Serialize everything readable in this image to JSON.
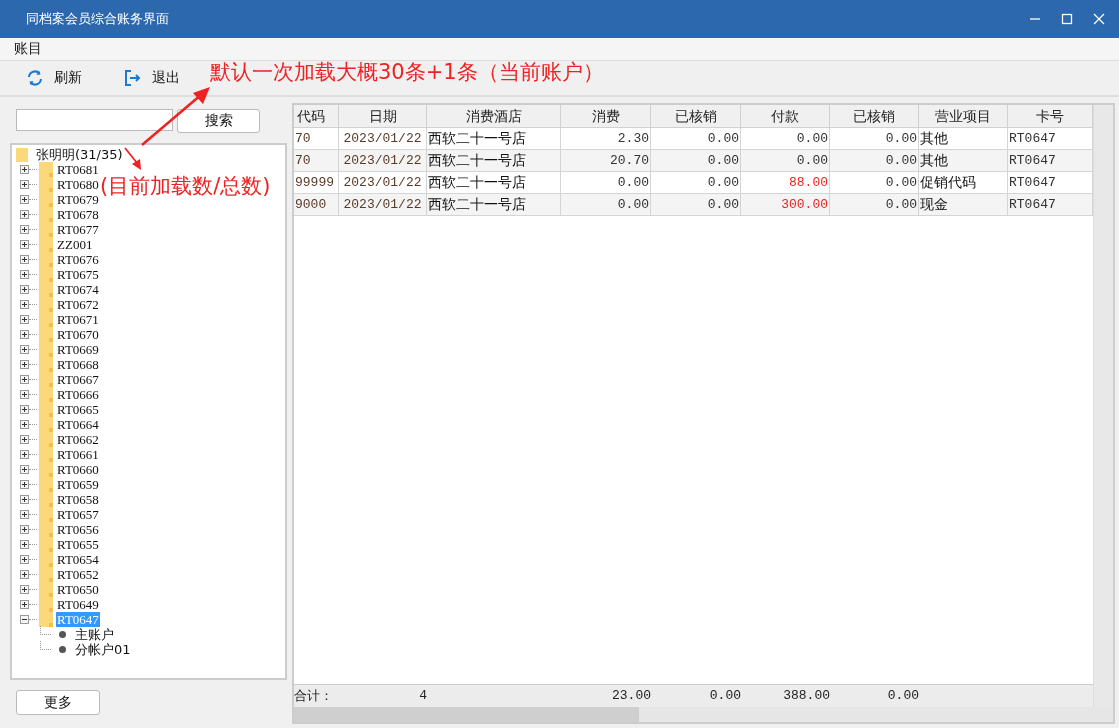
{
  "window": {
    "title": "同档案会员综合账务界面"
  },
  "menu": [
    "账目"
  ],
  "toolbar": [
    {
      "kind": "refresh",
      "label": "刷新"
    },
    {
      "kind": "exit",
      "label": "退出"
    }
  ],
  "search": {
    "button": "搜索"
  },
  "tree": {
    "label": "张明明(31/35)",
    "children": [
      {
        "label": "RT0681",
        "expanded": false,
        "selected": false
      },
      {
        "label": "RT0680",
        "expanded": false,
        "selected": false
      },
      {
        "label": "RT0679",
        "expanded": false,
        "selected": false
      },
      {
        "label": "RT0678",
        "expanded": false,
        "selected": false
      },
      {
        "label": "RT0677",
        "expanded": false,
        "selected": false
      },
      {
        "label": "ZZ001",
        "expanded": false,
        "selected": false
      },
      {
        "label": "RT0676",
        "expanded": false,
        "selected": false
      },
      {
        "label": "RT0675",
        "expanded": false,
        "selected": false
      },
      {
        "label": "RT0674",
        "expanded": false,
        "selected": false
      },
      {
        "label": "RT0672",
        "expanded": false,
        "selected": false
      },
      {
        "label": "RT0671",
        "expanded": false,
        "selected": false
      },
      {
        "label": "RT0670",
        "expanded": false,
        "selected": false
      },
      {
        "label": "RT0669",
        "expanded": false,
        "selected": false
      },
      {
        "label": "RT0668",
        "expanded": false,
        "selected": false
      },
      {
        "label": "RT0667",
        "expanded": false,
        "selected": false
      },
      {
        "label": "RT0666",
        "expanded": false,
        "selected": false
      },
      {
        "label": "RT0665",
        "expanded": false,
        "selected": false
      },
      {
        "label": "RT0664",
        "expanded": false,
        "selected": false
      },
      {
        "label": "RT0662",
        "expanded": false,
        "selected": false
      },
      {
        "label": "RT0661",
        "expanded": false,
        "selected": false
      },
      {
        "label": "RT0660",
        "expanded": false,
        "selected": false
      },
      {
        "label": "RT0659",
        "expanded": false,
        "selected": false
      },
      {
        "label": "RT0658",
        "expanded": false,
        "selected": false
      },
      {
        "label": "RT0657",
        "expanded": false,
        "selected": false
      },
      {
        "label": "RT0656",
        "expanded": false,
        "selected": false
      },
      {
        "label": "RT0655",
        "expanded": false,
        "selected": false
      },
      {
        "label": "RT0654",
        "expanded": false,
        "selected": false
      },
      {
        "label": "RT0652",
        "expanded": false,
        "selected": false
      },
      {
        "label": "RT0650",
        "expanded": false,
        "selected": false
      },
      {
        "label": "RT0649",
        "expanded": false,
        "selected": false
      },
      {
        "label": "RT0647",
        "expanded": true,
        "selected": true,
        "children": [
          {
            "label": "主账户"
          },
          {
            "label": "分帐户01"
          }
        ]
      }
    ]
  },
  "more_button": "更多",
  "table": {
    "columns": [
      "代码",
      "日期",
      "消费酒店",
      "消费",
      "已核销",
      "付款",
      "已核销",
      "营业项目",
      "卡号"
    ],
    "rows": [
      {
        "code": "70",
        "date": "2023/01/22",
        "hotel": "西软二十一号店",
        "consumption": "2.30",
        "written_off": "0.00",
        "payment": {
          "text": "0.00",
          "color": "#333333"
        },
        "payment_written_off": "0.00",
        "item": "其他",
        "card": "RT0647"
      },
      {
        "code": "70",
        "date": "2023/01/22",
        "hotel": "西软二十一号店",
        "consumption": "20.70",
        "written_off": "0.00",
        "payment": {
          "text": "0.00",
          "color": "#333333"
        },
        "payment_written_off": "0.00",
        "item": "其他",
        "card": "RT0647"
      },
      {
        "code": "99999",
        "date": "2023/01/22",
        "hotel": "西软二十一号店",
        "consumption": "0.00",
        "written_off": "0.00",
        "payment": {
          "text": "88.00",
          "color": "#ee2222"
        },
        "payment_written_off": "0.00",
        "item": "促销代码",
        "card": "RT0647"
      },
      {
        "code": "9000",
        "date": "2023/01/22",
        "hotel": "西软二十一号店",
        "consumption": "0.00",
        "written_off": "0.00",
        "payment": {
          "text": "300.00",
          "color": "#ee2222"
        },
        "payment_written_off": "0.00",
        "item": "现金",
        "card": "RT0647"
      }
    ],
    "totals": {
      "label": "合计：",
      "count": "4",
      "consumption": "23.00",
      "written_off": "0.00",
      "payment": "388.00",
      "payment_written_off": "0.00"
    }
  },
  "annotations": [
    {
      "text": "默认一次加载大概30条+1条（当前账户）"
    },
    {
      "text": "(目前加载数/总数)"
    }
  ]
}
